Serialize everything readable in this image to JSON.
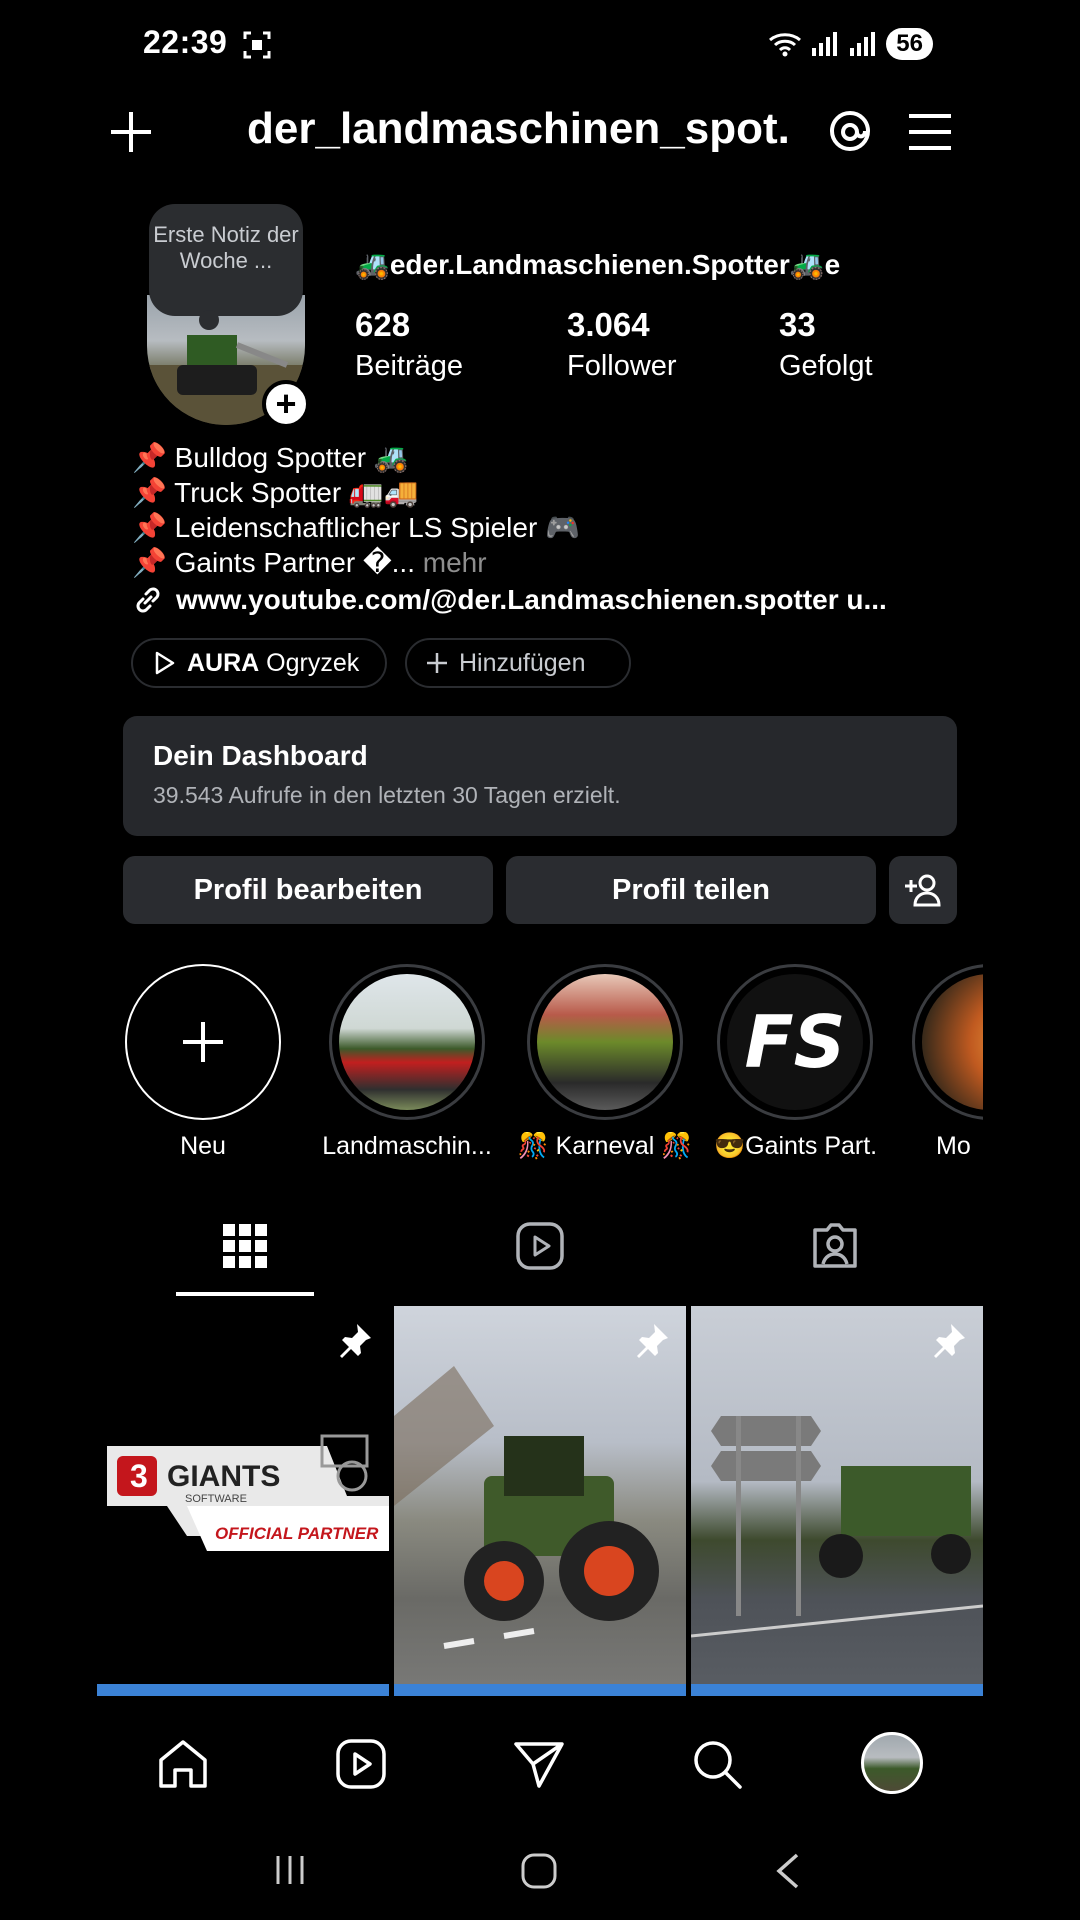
{
  "status": {
    "time": "22:39",
    "battery": "56"
  },
  "header": {
    "title": "der_landmaschinen_spot..."
  },
  "profile": {
    "note": "Erste Notiz der Woche ...",
    "display_name": "🚜eder.Landmaschienen.Spotter🚜e",
    "stats": [
      {
        "value": "628",
        "label": "Beiträge"
      },
      {
        "value": "3.064",
        "label": "Follower"
      },
      {
        "value": "33",
        "label": "Gefolgt"
      }
    ],
    "bio": [
      "📌 Bulldog Spotter 🚜",
      "📌 Truck Spotter 🚛🚚",
      "📌 Leidenschaftlicher LS Spieler 🎮",
      "📌 Gaints Partner �..."
    ],
    "more": "mehr",
    "link": "www.youtube.com/@der.Landmaschienen.spotter u..."
  },
  "chips": {
    "music_artist": "AURA",
    "music_title": "Ogryzek",
    "add": "Hinzufügen"
  },
  "dashboard": {
    "title": "Dein Dashboard",
    "subtitle": "39.543 Aufrufe in den letzten 30 Tagen erzielt."
  },
  "buttons": {
    "edit": "Profil bearbeiten",
    "share": "Profil teilen"
  },
  "highlights": [
    {
      "label": "Neu"
    },
    {
      "label": "Landmaschin..."
    },
    {
      "label": "🎊 Karneval 🎊"
    },
    {
      "label": "😎Gaints Part..."
    },
    {
      "label": "Mo"
    }
  ],
  "grid": {
    "post1_brand": "GIANTS",
    "post1_sub": "SOFTWARE",
    "post1_tag": "OFFICIAL PARTNER"
  },
  "highlight_fs_text": "FS",
  "colors": {
    "background": "#000000",
    "surface": "#26282c",
    "accent_blue": "#3b82d6"
  }
}
